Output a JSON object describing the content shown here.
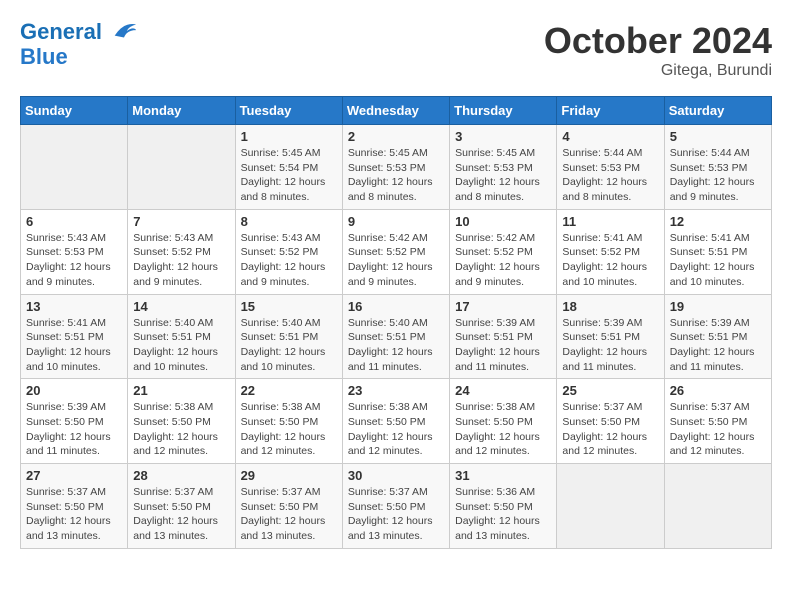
{
  "logo": {
    "line1": "General",
    "line2": "Blue"
  },
  "title": "October 2024",
  "location": "Gitega, Burundi",
  "days_of_week": [
    "Sunday",
    "Monday",
    "Tuesday",
    "Wednesday",
    "Thursday",
    "Friday",
    "Saturday"
  ],
  "weeks": [
    [
      {
        "day": "",
        "info": ""
      },
      {
        "day": "",
        "info": ""
      },
      {
        "day": "1",
        "info": "Sunrise: 5:45 AM\nSunset: 5:54 PM\nDaylight: 12 hours and 8 minutes."
      },
      {
        "day": "2",
        "info": "Sunrise: 5:45 AM\nSunset: 5:53 PM\nDaylight: 12 hours and 8 minutes."
      },
      {
        "day": "3",
        "info": "Sunrise: 5:45 AM\nSunset: 5:53 PM\nDaylight: 12 hours and 8 minutes."
      },
      {
        "day": "4",
        "info": "Sunrise: 5:44 AM\nSunset: 5:53 PM\nDaylight: 12 hours and 8 minutes."
      },
      {
        "day": "5",
        "info": "Sunrise: 5:44 AM\nSunset: 5:53 PM\nDaylight: 12 hours and 9 minutes."
      }
    ],
    [
      {
        "day": "6",
        "info": "Sunrise: 5:43 AM\nSunset: 5:53 PM\nDaylight: 12 hours and 9 minutes."
      },
      {
        "day": "7",
        "info": "Sunrise: 5:43 AM\nSunset: 5:52 PM\nDaylight: 12 hours and 9 minutes."
      },
      {
        "day": "8",
        "info": "Sunrise: 5:43 AM\nSunset: 5:52 PM\nDaylight: 12 hours and 9 minutes."
      },
      {
        "day": "9",
        "info": "Sunrise: 5:42 AM\nSunset: 5:52 PM\nDaylight: 12 hours and 9 minutes."
      },
      {
        "day": "10",
        "info": "Sunrise: 5:42 AM\nSunset: 5:52 PM\nDaylight: 12 hours and 9 minutes."
      },
      {
        "day": "11",
        "info": "Sunrise: 5:41 AM\nSunset: 5:52 PM\nDaylight: 12 hours and 10 minutes."
      },
      {
        "day": "12",
        "info": "Sunrise: 5:41 AM\nSunset: 5:51 PM\nDaylight: 12 hours and 10 minutes."
      }
    ],
    [
      {
        "day": "13",
        "info": "Sunrise: 5:41 AM\nSunset: 5:51 PM\nDaylight: 12 hours and 10 minutes."
      },
      {
        "day": "14",
        "info": "Sunrise: 5:40 AM\nSunset: 5:51 PM\nDaylight: 12 hours and 10 minutes."
      },
      {
        "day": "15",
        "info": "Sunrise: 5:40 AM\nSunset: 5:51 PM\nDaylight: 12 hours and 10 minutes."
      },
      {
        "day": "16",
        "info": "Sunrise: 5:40 AM\nSunset: 5:51 PM\nDaylight: 12 hours and 11 minutes."
      },
      {
        "day": "17",
        "info": "Sunrise: 5:39 AM\nSunset: 5:51 PM\nDaylight: 12 hours and 11 minutes."
      },
      {
        "day": "18",
        "info": "Sunrise: 5:39 AM\nSunset: 5:51 PM\nDaylight: 12 hours and 11 minutes."
      },
      {
        "day": "19",
        "info": "Sunrise: 5:39 AM\nSunset: 5:51 PM\nDaylight: 12 hours and 11 minutes."
      }
    ],
    [
      {
        "day": "20",
        "info": "Sunrise: 5:39 AM\nSunset: 5:50 PM\nDaylight: 12 hours and 11 minutes."
      },
      {
        "day": "21",
        "info": "Sunrise: 5:38 AM\nSunset: 5:50 PM\nDaylight: 12 hours and 12 minutes."
      },
      {
        "day": "22",
        "info": "Sunrise: 5:38 AM\nSunset: 5:50 PM\nDaylight: 12 hours and 12 minutes."
      },
      {
        "day": "23",
        "info": "Sunrise: 5:38 AM\nSunset: 5:50 PM\nDaylight: 12 hours and 12 minutes."
      },
      {
        "day": "24",
        "info": "Sunrise: 5:38 AM\nSunset: 5:50 PM\nDaylight: 12 hours and 12 minutes."
      },
      {
        "day": "25",
        "info": "Sunrise: 5:37 AM\nSunset: 5:50 PM\nDaylight: 12 hours and 12 minutes."
      },
      {
        "day": "26",
        "info": "Sunrise: 5:37 AM\nSunset: 5:50 PM\nDaylight: 12 hours and 12 minutes."
      }
    ],
    [
      {
        "day": "27",
        "info": "Sunrise: 5:37 AM\nSunset: 5:50 PM\nDaylight: 12 hours and 13 minutes."
      },
      {
        "day": "28",
        "info": "Sunrise: 5:37 AM\nSunset: 5:50 PM\nDaylight: 12 hours and 13 minutes."
      },
      {
        "day": "29",
        "info": "Sunrise: 5:37 AM\nSunset: 5:50 PM\nDaylight: 12 hours and 13 minutes."
      },
      {
        "day": "30",
        "info": "Sunrise: 5:37 AM\nSunset: 5:50 PM\nDaylight: 12 hours and 13 minutes."
      },
      {
        "day": "31",
        "info": "Sunrise: 5:36 AM\nSunset: 5:50 PM\nDaylight: 12 hours and 13 minutes."
      },
      {
        "day": "",
        "info": ""
      },
      {
        "day": "",
        "info": ""
      }
    ]
  ]
}
